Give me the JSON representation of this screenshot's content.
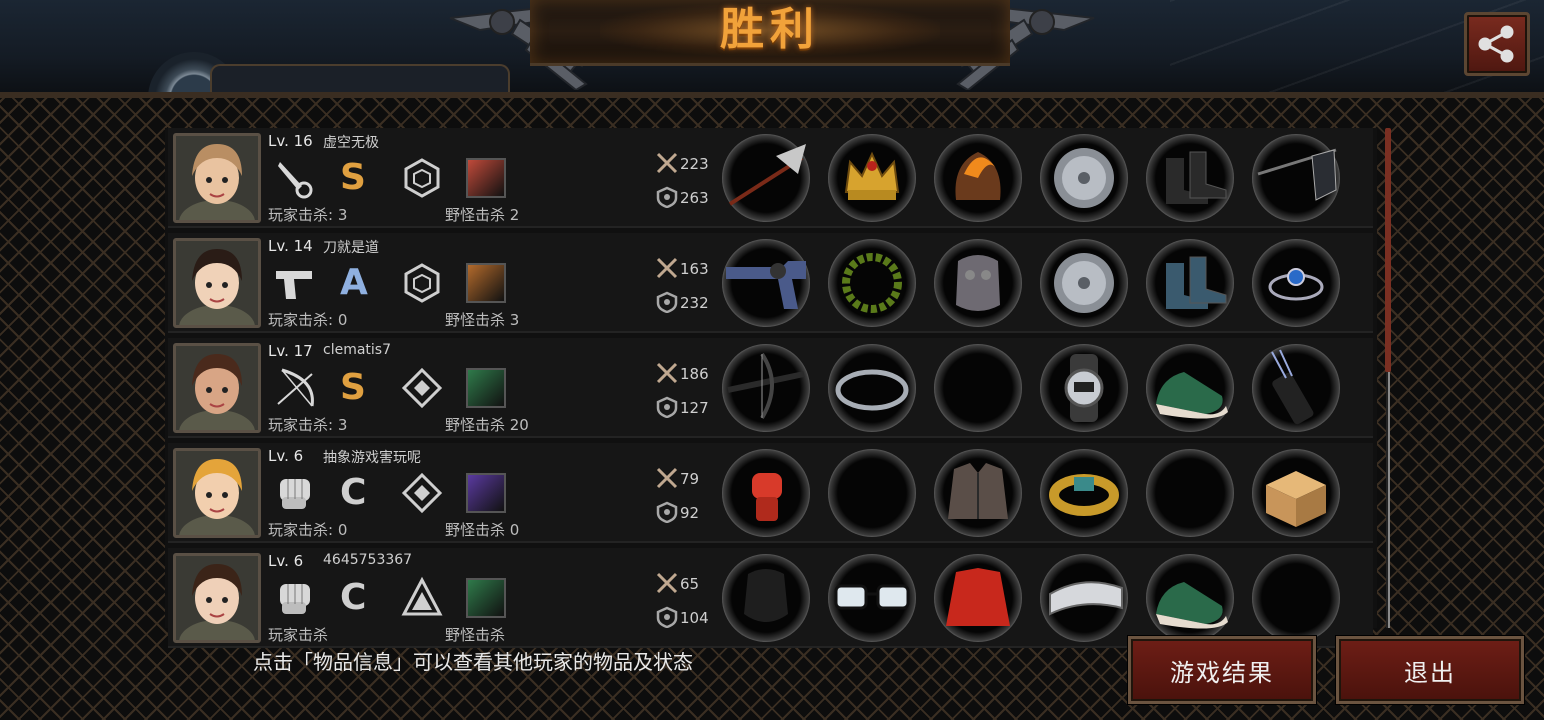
{
  "header": {
    "title": "胜利"
  },
  "players": [
    {
      "level": "Lv. 16",
      "name": "虚空无极",
      "weapon_icon": "knife-icon",
      "grade": "S",
      "rank_icon": "hexagon-rank-icon",
      "player_kills_label": "玩家击杀: 3",
      "monster_kills_label": "野怪击杀 2",
      "attack": "223",
      "defense": "263",
      "items": [
        "halberd-icon",
        "crown-icon",
        "flame-armor-icon",
        "disc-icon",
        "combat-boots-icon",
        "flag-icon"
      ]
    },
    {
      "level": "Lv. 14",
      "name": "刀就是道",
      "weapon_icon": "pistol-icon",
      "grade": "A",
      "rank_icon": "hexagon-rank-icon",
      "player_kills_label": "玩家击杀: 0",
      "monster_kills_label": "野怪击杀 3",
      "attack": "163",
      "defense": "232",
      "items": [
        "revolver-icon",
        "laurel-wreath-icon",
        "gauntlet-armor-icon",
        "disc-icon",
        "blue-boots-icon",
        "sapphire-bracelet-icon"
      ]
    },
    {
      "level": "Lv. 17",
      "name": "clematis7",
      "weapon_icon": "bow-icon",
      "grade": "S",
      "rank_icon": "diamond-rank-icon",
      "player_kills_label": "玩家击杀: 3",
      "monster_kills_label": "野怪击杀 20",
      "attack": "186",
      "defense": "127",
      "items": [
        "crossbow-icon",
        "headband-icon",
        "empty-slot",
        "watch-icon",
        "sneakers-icon",
        "quiver-icon"
      ]
    },
    {
      "level": "Lv. 6",
      "name": "抽象游戏害玩呢",
      "weapon_icon": "fist-icon",
      "grade": "C",
      "rank_icon": "diamond-rank-icon",
      "player_kills_label": "玩家击杀: 0",
      "monster_kills_label": "野怪击杀 0",
      "attack": "79",
      "defense": "92",
      "items": [
        "red-fist-icon",
        "empty-slot",
        "leather-jacket-icon",
        "gold-bracelet-icon",
        "empty-slot",
        "cardboard-box-icon"
      ]
    },
    {
      "level": "Lv. 6",
      "name": "4645753367",
      "weapon_icon": "fist-icon",
      "grade": "C",
      "rank_icon": "triangle-rank-icon",
      "player_kills_label": "玩家击杀",
      "monster_kills_label": "野怪击杀",
      "attack": "65",
      "defense": "104",
      "items": [
        "black-glove-icon",
        "glasses-icon",
        "red-jacket-icon",
        "arm-guard-icon",
        "sneakers-icon",
        "empty-slot"
      ]
    }
  ],
  "footer": {
    "hint": "点击「物品信息」可以查看其他玩家的物品及状态",
    "result_button": "游戏结果",
    "exit_button": "退出"
  },
  "colors": {
    "accent": "#f1a23a",
    "button": "#6e1e16",
    "lattice": "#3a2e22"
  }
}
